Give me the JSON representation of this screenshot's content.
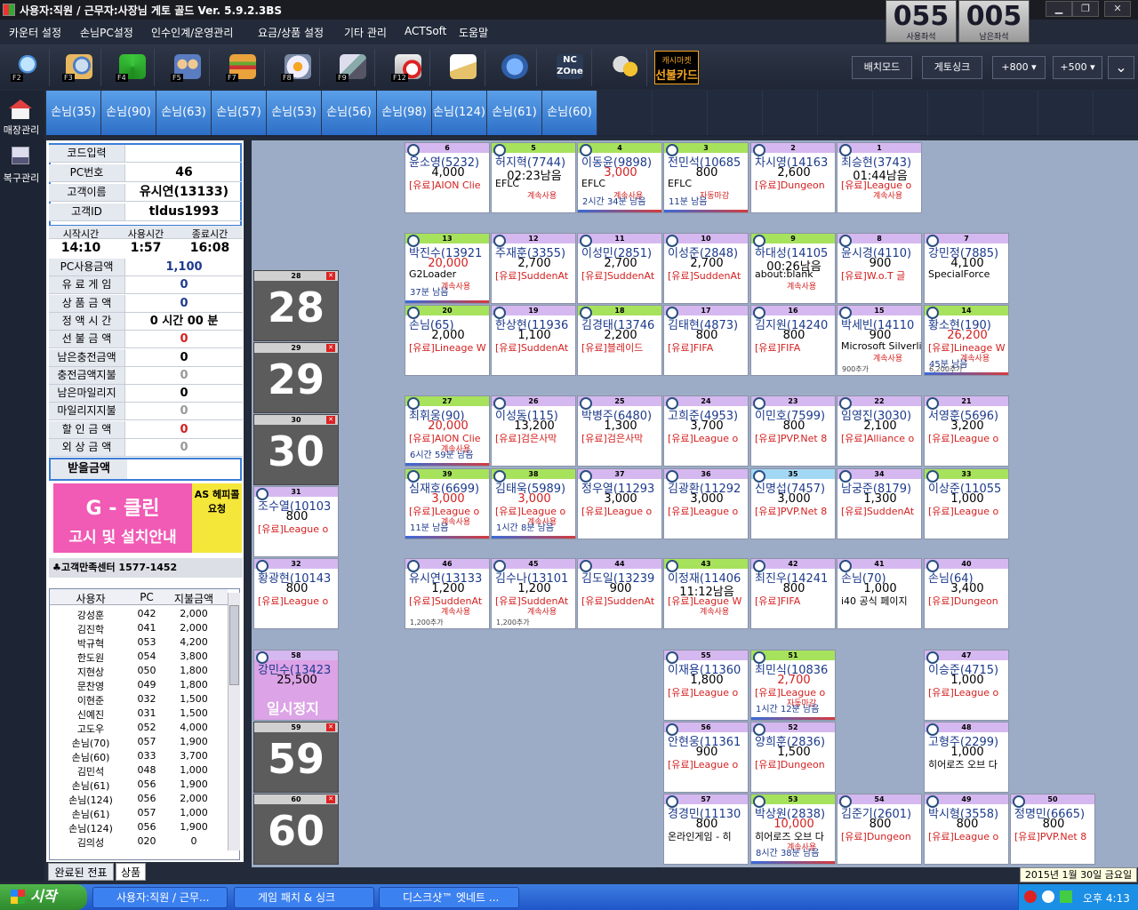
{
  "window": {
    "title": "사용자:직원 / 근무자:사장님  게토 골드 Ver. 5.9.2.3BS"
  },
  "menu": [
    "카운터 설정",
    "손님PC설정",
    "인수인계/운영관리",
    "요금/상품 설정",
    "기타 관리",
    "ACTSoft",
    "도움말"
  ],
  "counters": [
    {
      "value": "055",
      "label": "사용좌석"
    },
    {
      "value": "005",
      "label": "남은좌석"
    }
  ],
  "toolbar": {
    "keys": [
      "F2",
      "F3",
      "F4",
      "F5",
      "F7",
      "F8",
      "F9",
      "F12"
    ],
    "cashier_card": [
      "캐시마켓",
      "선불카드"
    ],
    "right_buttons": [
      "배치모드",
      "게토싱크",
      "+800",
      "+500"
    ]
  },
  "left_nav": [
    "매장관리",
    "복구관리"
  ],
  "tabs": [
    "손님(35)",
    "손님(90)",
    "손님(63)",
    "손님(57)",
    "손님(53)",
    "손님(56)",
    "손님(98)",
    "손님(124)",
    "손님(61)",
    "손님(60)"
  ],
  "info": {
    "code_input_label": "코드입력",
    "pc_label": "PC번호",
    "pc_value": "46",
    "cust_label": "고객이름",
    "cust_value": "유시연(13133)",
    "id_label": "고객ID",
    "id_value": "tldus1993",
    "time_heads": [
      "시작시간",
      "사용시간",
      "종료시간"
    ],
    "time_vals": [
      "14:10",
      "1:57",
      "16:08"
    ],
    "rows": [
      {
        "label": "PC사용금액",
        "value": "1,100",
        "color": "#1c3a8c"
      },
      {
        "label": "유 료 게 임",
        "value": "0",
        "color": "#1c3a8c"
      },
      {
        "label": "상 품 금 액",
        "value": "0",
        "color": "#1c3a8c"
      },
      {
        "label": "정 액 시 간",
        "value": "0   시간  00   분",
        "color": "#000000"
      },
      {
        "label": "선 불 금 액",
        "value": "0",
        "color": "#d42020"
      },
      {
        "label": "남은충전금액",
        "value": "0",
        "color": "#000000"
      },
      {
        "label": "충전금액지불",
        "value": "0",
        "color": "#999999"
      },
      {
        "label": "남은마일리지",
        "value": "0",
        "color": "#000000"
      },
      {
        "label": "마일리지지불",
        "value": "0",
        "color": "#999999"
      },
      {
        "label": "할 인 금 액",
        "value": "0",
        "color": "#d42020"
      },
      {
        "label": "외 상 금 액",
        "value": "0",
        "color": "#999999"
      }
    ],
    "receive_label": "받을금액"
  },
  "promo": {
    "line1": "G - 클린",
    "line2": "고시 및 설치안내",
    "side": "AS 헤피콜 요청",
    "center": "♣고객만족센터  1577-1452"
  },
  "payments": {
    "headers": [
      "사용자",
      "PC",
      "지불금액"
    ],
    "rows": [
      [
        "강성훈",
        "042",
        "2,000"
      ],
      [
        "김진학",
        "041",
        "2,000"
      ],
      [
        "박규혁",
        "053",
        "4,200"
      ],
      [
        "한도원",
        "054",
        "3,800"
      ],
      [
        "지현상",
        "050",
        "1,800"
      ],
      [
        "문찬영",
        "049",
        "1,800"
      ],
      [
        "이현준",
        "032",
        "1,500"
      ],
      [
        "신예진",
        "031",
        "1,500"
      ],
      [
        "고도우",
        "052",
        "4,000"
      ],
      [
        "손님(70)",
        "057",
        "1,900"
      ],
      [
        "손님(60)",
        "033",
        "3,700"
      ],
      [
        "김민석",
        "048",
        "1,000"
      ],
      [
        "손님(61)",
        "056",
        "1,900"
      ],
      [
        "손님(124)",
        "056",
        "2,000"
      ],
      [
        "손님(61)",
        "057",
        "1,000"
      ],
      [
        "손님(124)",
        "056",
        "1,900"
      ],
      [
        "김의성",
        "020",
        "0"
      ]
    ],
    "tabs": [
      "완료된 전표",
      "상품"
    ]
  },
  "seats": [
    {
      "n": "6",
      "name": "윤소영(5232)",
      "amt": "4,000",
      "amt_red": false,
      "game": "[유료]AION Clie",
      "game_red": true,
      "status": "",
      "remain": "",
      "extra": "",
      "hdr": "#d6b8f0"
    },
    {
      "n": "5",
      "name": "허지혁(7744)",
      "amt": "02:23남음",
      "amt_red": false,
      "game": "EFLC",
      "game_red": false,
      "status": "계속사용",
      "remain": "",
      "extra": "",
      "hdr": "#a7e25c"
    },
    {
      "n": "4",
      "name": "이동윤(9898)",
      "amt": "3,000",
      "amt_red": true,
      "game": "EFLC",
      "game_red": false,
      "status": "계속사용",
      "remain": "2시간 34분 남음",
      "extra": "",
      "hdr": "#a7e25c"
    },
    {
      "n": "3",
      "name": "전민석(10685",
      "amt": "800",
      "amt_red": false,
      "game": "EFLC",
      "game_red": false,
      "status": "자동마감",
      "remain": "11분 남음",
      "extra": "",
      "hdr": "#a7e25c"
    },
    {
      "n": "2",
      "name": "차시영(14163",
      "amt": "2,600",
      "amt_red": false,
      "game": "[유료]Dungeon",
      "game_red": true,
      "status": "",
      "remain": "",
      "extra": "",
      "hdr": "#d6b8f0"
    },
    {
      "n": "1",
      "name": "최승현(3743)",
      "amt": "01:44남음",
      "amt_red": false,
      "game": "[유료]League o",
      "game_red": true,
      "status": "계속사용",
      "remain": "",
      "extra": "",
      "hdr": "#d6b8f0"
    },
    {
      "n": "13",
      "name": "박진수(13921",
      "amt": "20,000",
      "amt_red": true,
      "game": "G2Loader",
      "game_red": false,
      "status": "계속사용",
      "remain": "37분 남음",
      "extra": "",
      "hdr": "#a7e25c"
    },
    {
      "n": "12",
      "name": "주재훈(3355)",
      "amt": "2,700",
      "amt_red": false,
      "game": "[유료]SuddenAt",
      "game_red": true,
      "status": "",
      "remain": "",
      "extra": "",
      "hdr": "#d6b8f0"
    },
    {
      "n": "11",
      "name": "이성민(2851)",
      "amt": "2,700",
      "amt_red": false,
      "game": "[유료]SuddenAt",
      "game_red": true,
      "status": "",
      "remain": "",
      "extra": "",
      "hdr": "#d6b8f0"
    },
    {
      "n": "10",
      "name": "이성준(2848)",
      "amt": "2,700",
      "amt_red": false,
      "game": "[유료]SuddenAt",
      "game_red": true,
      "status": "",
      "remain": "",
      "extra": "",
      "hdr": "#d6b8f0"
    },
    {
      "n": "9",
      "name": "하대성(14105",
      "amt": "00:26남음",
      "amt_red": false,
      "game": "about:blank",
      "game_red": false,
      "status": "계속사용",
      "remain": "",
      "extra": "",
      "hdr": "#a7e25c"
    },
    {
      "n": "8",
      "name": "윤시경(4110)",
      "amt": "900",
      "amt_red": false,
      "game": "[유료]W.o.T 글",
      "game_red": true,
      "status": "",
      "remain": "",
      "extra": "",
      "hdr": "#d6b8f0"
    },
    {
      "n": "7",
      "name": "강민정(7885)",
      "amt": "4,100",
      "amt_red": false,
      "game": "SpecialForce",
      "game_red": false,
      "status": "",
      "remain": "",
      "extra": "",
      "hdr": "#d6b8f0"
    },
    {
      "n": "20",
      "name": "손님(65)",
      "amt": "2,000",
      "amt_red": false,
      "game": "[유료]Lineage W",
      "game_red": true,
      "status": "",
      "remain": "",
      "extra": "",
      "hdr": "#a7e25c"
    },
    {
      "n": "19",
      "name": "한상현(11936",
      "amt": "1,100",
      "amt_red": false,
      "game": "[유료]SuddenAt",
      "game_red": true,
      "status": "",
      "remain": "",
      "extra": "",
      "hdr": "#d6b8f0"
    },
    {
      "n": "18",
      "name": "김경태(13746",
      "amt": "2,200",
      "amt_red": false,
      "game": "[유료]블레이드",
      "game_red": true,
      "status": "",
      "remain": "",
      "extra": "",
      "hdr": "#a7e25c"
    },
    {
      "n": "17",
      "name": "김태현(4873)",
      "amt": "800",
      "amt_red": false,
      "game": "[유료]FIFA",
      "game_red": true,
      "status": "",
      "remain": "",
      "extra": "",
      "hdr": "#d6b8f0"
    },
    {
      "n": "16",
      "name": "김지원(14240",
      "amt": "800",
      "amt_red": false,
      "game": "[유료]FIFA",
      "game_red": true,
      "status": "",
      "remain": "",
      "extra": "",
      "hdr": "#d6b8f0"
    },
    {
      "n": "15",
      "name": "박세빈(14110",
      "amt": "900",
      "amt_red": false,
      "game": "Microsoft Silverlig",
      "game_red": false,
      "status": "계속사용",
      "remain": "",
      "extra": "900추가",
      "hdr": "#d6b8f0"
    },
    {
      "n": "14",
      "name": "황소현(190)",
      "amt": "26,200",
      "amt_red": true,
      "game": "[유료]Lineage W",
      "game_red": true,
      "status": "계속사용",
      "remain": "45분 남음",
      "extra": "6,200추가",
      "hdr": "#a7e25c"
    },
    {
      "n": "27",
      "name": "최휘웅(90)",
      "amt": "20,000",
      "amt_red": true,
      "game": "[유료]AION Clie",
      "game_red": true,
      "status": "계속사용",
      "remain": "6시간 59분 남음",
      "extra": "",
      "hdr": "#a7e25c"
    },
    {
      "n": "26",
      "name": "이성동(115)",
      "amt": "13,200",
      "amt_red": false,
      "game": "[유료]검은사막",
      "game_red": true,
      "status": "",
      "remain": "",
      "extra": "",
      "hdr": "#d6b8f0"
    },
    {
      "n": "25",
      "name": "박병주(6480)",
      "amt": "1,300",
      "amt_red": false,
      "game": "[유료]검은사막",
      "game_red": true,
      "status": "",
      "remain": "",
      "extra": "",
      "hdr": "#d6b8f0"
    },
    {
      "n": "24",
      "name": "고희준(4953)",
      "amt": "3,700",
      "amt_red": false,
      "game": "[유료]League o",
      "game_red": true,
      "status": "",
      "remain": "",
      "extra": "",
      "hdr": "#d6b8f0"
    },
    {
      "n": "23",
      "name": "이민호(7599)",
      "amt": "800",
      "amt_red": false,
      "game": "[유료]PVP.Net 8",
      "game_red": true,
      "status": "",
      "remain": "",
      "extra": "",
      "hdr": "#d6b8f0"
    },
    {
      "n": "22",
      "name": "임영진(3030)",
      "amt": "2,100",
      "amt_red": false,
      "game": "[유료]Alliance o",
      "game_red": true,
      "status": "",
      "remain": "",
      "extra": "",
      "hdr": "#d6b8f0"
    },
    {
      "n": "21",
      "name": "서영훈(5696)",
      "amt": "3,200",
      "amt_red": false,
      "game": "[유료]League o",
      "game_red": true,
      "status": "",
      "remain": "",
      "extra": "",
      "hdr": "#d6b8f0"
    },
    {
      "n": "39",
      "name": "심재호(6699)",
      "amt": "3,000",
      "amt_red": true,
      "game": "[유료]League o",
      "game_red": true,
      "status": "계속사용",
      "remain": "11분 남음",
      "extra": "",
      "hdr": "#a7e25c"
    },
    {
      "n": "38",
      "name": "김태욱(5989)",
      "amt": "3,000",
      "amt_red": true,
      "game": "[유료]League o",
      "game_red": true,
      "status": "계속사용",
      "remain": "1시간 8분 남음",
      "extra": "",
      "hdr": "#a7e25c"
    },
    {
      "n": "37",
      "name": "정우열(11293",
      "amt": "3,000",
      "amt_red": false,
      "game": "[유료]League o",
      "game_red": true,
      "status": "",
      "remain": "",
      "extra": "",
      "hdr": "#d6b8f0"
    },
    {
      "n": "36",
      "name": "김광환(11292",
      "amt": "3,000",
      "amt_red": false,
      "game": "[유료]League o",
      "game_red": true,
      "status": "",
      "remain": "",
      "extra": "",
      "hdr": "#d6b8f0"
    },
    {
      "n": "35",
      "name": "신명섭(7457)",
      "amt": "3,000",
      "amt_red": false,
      "game": "[유료]PVP.Net 8",
      "game_red": true,
      "status": "",
      "remain": "",
      "extra": "",
      "hdr": "#a3d8f4"
    },
    {
      "n": "34",
      "name": "남궁준(8179)",
      "amt": "1,300",
      "amt_red": false,
      "game": "[유료]SuddenAt",
      "game_red": true,
      "status": "",
      "remain": "",
      "extra": "",
      "hdr": "#d6b8f0"
    },
    {
      "n": "33",
      "name": "이상준(11055",
      "amt": "1,000",
      "amt_red": false,
      "game": "[유료]League o",
      "game_red": true,
      "status": "",
      "remain": "",
      "extra": "",
      "hdr": "#a7e25c"
    },
    {
      "n": "31",
      "name": "조수열(10103",
      "amt": "800",
      "amt_red": false,
      "game": "[유료]League o",
      "game_red": true,
      "status": "",
      "remain": "",
      "extra": "",
      "hdr": "#d6b8f0"
    },
    {
      "n": "46",
      "name": "유시연(13133",
      "amt": "1,200",
      "amt_red": false,
      "game": "[유료]SuddenAt",
      "game_red": true,
      "status": "계속사용",
      "remain": "",
      "extra": "1,200추가",
      "hdr": "#d6b8f0"
    },
    {
      "n": "45",
      "name": "김수나(13101",
      "amt": "1,200",
      "amt_red": false,
      "game": "[유료]SuddenAt",
      "game_red": true,
      "status": "계속사용",
      "remain": "",
      "extra": "1,200추가",
      "hdr": "#d6b8f0"
    },
    {
      "n": "44",
      "name": "김도일(13239",
      "amt": "900",
      "amt_red": false,
      "game": "[유료]SuddenAt",
      "game_red": true,
      "status": "",
      "remain": "",
      "extra": "",
      "hdr": "#d6b8f0"
    },
    {
      "n": "43",
      "name": "이정재(11406",
      "amt": "11:12남음",
      "amt_red": false,
      "game": "[유료]League W",
      "game_red": true,
      "status": "계속사용",
      "remain": "",
      "extra": "",
      "hdr": "#a7e25c"
    },
    {
      "n": "42",
      "name": "최진우(14241",
      "amt": "800",
      "amt_red": false,
      "game": "[유료]FIFA",
      "game_red": true,
      "status": "",
      "remain": "",
      "extra": "",
      "hdr": "#d6b8f0"
    },
    {
      "n": "41",
      "name": "손님(70)",
      "amt": "1,000",
      "amt_red": false,
      "game": "i40 공식 페이지",
      "game_red": false,
      "status": "",
      "remain": "",
      "extra": "",
      "hdr": "#d6b8f0"
    },
    {
      "n": "40",
      "name": "손님(64)",
      "amt": "3,400",
      "amt_red": false,
      "game": "[유료]Dungeon",
      "game_red": true,
      "status": "",
      "remain": "",
      "extra": "",
      "hdr": "#d6b8f0"
    },
    {
      "n": "32",
      "name": "황광현(10143",
      "amt": "800",
      "amt_red": false,
      "game": "[유료]League o",
      "game_red": true,
      "status": "",
      "remain": "",
      "extra": "",
      "hdr": "#d6b8f0"
    },
    {
      "n": "58",
      "name": "강민수(13423",
      "amt": "25,500",
      "amt_red": false,
      "game": "",
      "game_red": false,
      "status": "",
      "remain": "",
      "extra": "일시정지",
      "hdr": "#d6b8f0"
    },
    {
      "n": "55",
      "name": "이재용(11360",
      "amt": "1,800",
      "amt_red": false,
      "game": "[유료]League o",
      "game_red": true,
      "status": "",
      "remain": "",
      "extra": "",
      "hdr": "#d6b8f0"
    },
    {
      "n": "51",
      "name": "최민식(10836",
      "amt": "2,700",
      "amt_red": true,
      "game": "[유료]League o",
      "game_red": true,
      "status": "자동마감",
      "remain": "1시간 12분 남음",
      "extra": "",
      "hdr": "#a7e25c"
    },
    {
      "n": "47",
      "name": "이승준(4715)",
      "amt": "1,000",
      "amt_red": false,
      "game": "[유료]League o",
      "game_red": true,
      "status": "",
      "remain": "",
      "extra": "",
      "hdr": "#d6b8f0"
    },
    {
      "n": "56",
      "name": "안현웅(11361",
      "amt": "900",
      "amt_red": false,
      "game": "[유료]League o",
      "game_red": true,
      "status": "",
      "remain": "",
      "extra": "",
      "hdr": "#d6b8f0"
    },
    {
      "n": "52",
      "name": "양희훈(2836)",
      "amt": "1,500",
      "amt_red": false,
      "game": "[유료]Dungeon",
      "game_red": true,
      "status": "",
      "remain": "",
      "extra": "",
      "hdr": "#d6b8f0"
    },
    {
      "n": "48",
      "name": "고형주(2299)",
      "amt": "1,000",
      "amt_red": false,
      "game": "히어로즈 오브 다",
      "game_red": false,
      "status": "",
      "remain": "",
      "extra": "",
      "hdr": "#d6b8f0"
    },
    {
      "n": "57",
      "name": "경경민(11130",
      "amt": "800",
      "amt_red": false,
      "game": "온라인게임 - 히",
      "game_red": false,
      "status": "",
      "remain": "",
      "extra": "",
      "hdr": "#d6b8f0"
    },
    {
      "n": "53",
      "name": "박상원(2838)",
      "amt": "10,000",
      "amt_red": true,
      "game": "히어로즈 오브 다",
      "game_red": false,
      "status": "계속사용",
      "remain": "8시간 38분 남음",
      "extra": "",
      "hdr": "#a7e25c"
    },
    {
      "n": "54",
      "name": "김준기(2601)",
      "amt": "800",
      "amt_red": false,
      "game": "[유료]Dungeon",
      "game_red": true,
      "status": "",
      "remain": "",
      "extra": "",
      "hdr": "#d6b8f0"
    },
    {
      "n": "49",
      "name": "박시형(3558)",
      "amt": "800",
      "amt_red": false,
      "game": "[유료]League o",
      "game_red": true,
      "status": "",
      "remain": "",
      "extra": "",
      "hdr": "#d6b8f0"
    },
    {
      "n": "50",
      "name": "정명민(6665)",
      "amt": "800",
      "amt_red": false,
      "game": "[유료]PVP.Net 8",
      "game_red": true,
      "status": "",
      "remain": "",
      "extra": "",
      "hdr": "#d6b8f0"
    }
  ],
  "empty_seats": [
    "28",
    "29",
    "30",
    "59",
    "60"
  ],
  "taskbar": {
    "start": "시작",
    "tasks": [
      "사용자:직원 / 근무...",
      "게임 패치 & 싱크",
      "디스크샷™ 엣네트 ..."
    ],
    "clock": "오후 4:13",
    "date": "2015년 1월 30일 금요일"
  }
}
